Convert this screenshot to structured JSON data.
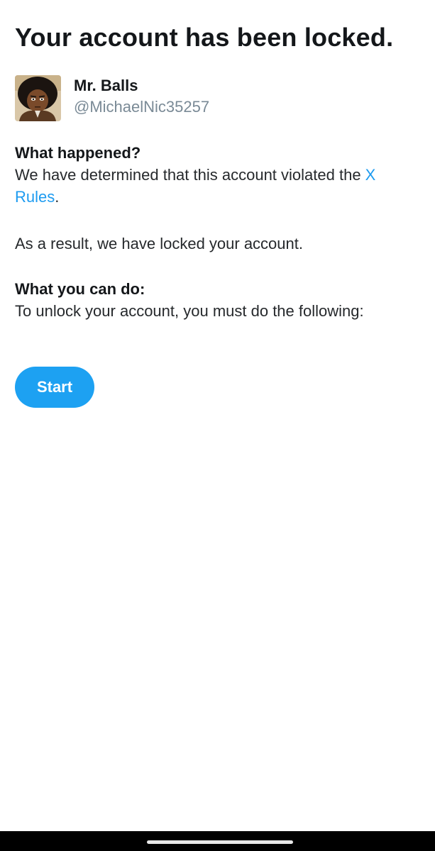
{
  "header": {
    "title": "Your account has been locked."
  },
  "user": {
    "display_name": "Mr. Balls",
    "handle": "@MichaelNic35257",
    "avatar_icon": "cartoon-avatar"
  },
  "what_happened": {
    "heading": "What happened?",
    "text_before_link": "We have determined that this account violated the ",
    "link_text": "X Rules",
    "text_after_link": "."
  },
  "result": {
    "text": "As a result, we have locked your account."
  },
  "what_you_can_do": {
    "heading": "What you can do:",
    "text": "To unlock your account, you must do the following:"
  },
  "actions": {
    "start_label": "Start"
  },
  "colors": {
    "accent": "#1da1f2",
    "link": "#1d9bf0",
    "secondary_text": "#7a8a96"
  }
}
